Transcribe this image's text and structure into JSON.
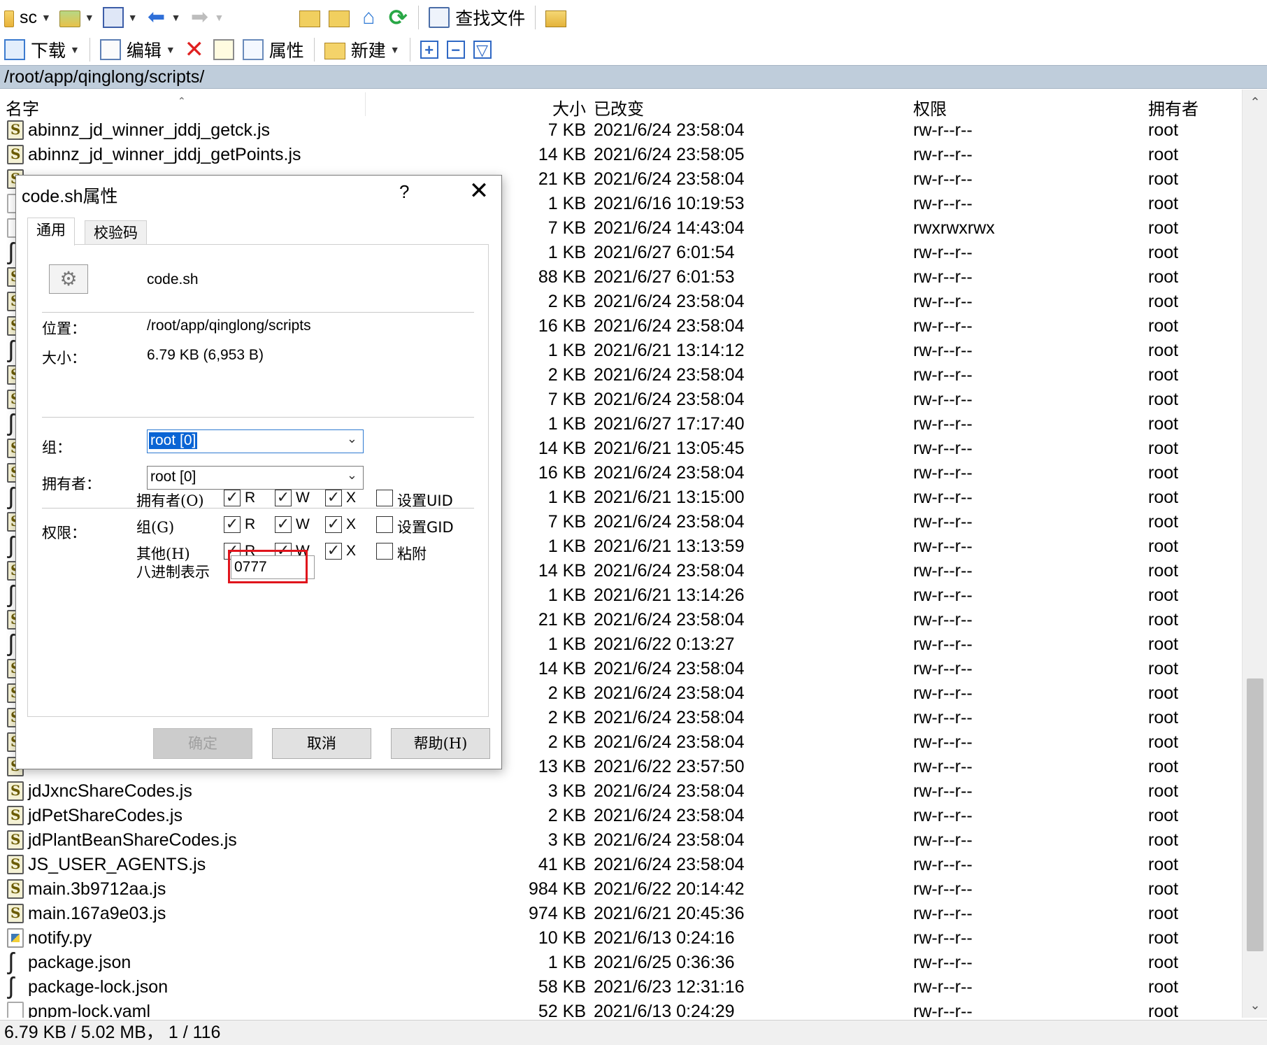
{
  "toolbar1": {
    "drive_label": "sc",
    "find_files_label": "查找文件"
  },
  "toolbar2": {
    "download_label": "下载",
    "edit_label": "编辑",
    "properties_label": "属性",
    "new_label": "新建"
  },
  "path": "/root/app/qinglong/scripts/",
  "columns": {
    "name": "名字",
    "size": "大小",
    "changed": "已改变",
    "rights": "权限",
    "owner": "拥有者"
  },
  "rows": [
    {
      "icon": "js",
      "name": "abinnz_jd_winner_jddj_getck.js",
      "size": "7 KB",
      "date": "2021/6/24 23:58:04",
      "perm": "rw-r--r--",
      "owner": "root"
    },
    {
      "icon": "js",
      "name": "abinnz_jd_winner_jddj_getPoints.js",
      "size": "14 KB",
      "date": "2021/6/24 23:58:05",
      "perm": "rw-r--r--",
      "owner": "root"
    },
    {
      "icon": "js",
      "name": "",
      "size": "21 KB",
      "date": "2021/6/24 23:58:04",
      "perm": "rw-r--r--",
      "owner": "root"
    },
    {
      "icon": "blank",
      "name": "",
      "size": "1 KB",
      "date": "2021/6/16 10:19:53",
      "perm": "rw-r--r--",
      "owner": "root"
    },
    {
      "icon": "blank",
      "name": "",
      "size": "7 KB",
      "date": "2021/6/24 14:43:04",
      "perm": "rwxrwxrwx",
      "owner": "root"
    },
    {
      "icon": "json",
      "name": "",
      "size": "1 KB",
      "date": "2021/6/27 6:01:54",
      "perm": "rw-r--r--",
      "owner": "root"
    },
    {
      "icon": "js",
      "name": "",
      "size": "88 KB",
      "date": "2021/6/27 6:01:53",
      "perm": "rw-r--r--",
      "owner": "root"
    },
    {
      "icon": "js",
      "name": "",
      "size": "2 KB",
      "date": "2021/6/24 23:58:04",
      "perm": "rw-r--r--",
      "owner": "root"
    },
    {
      "icon": "js",
      "name": "",
      "size": "16 KB",
      "date": "2021/6/24 23:58:04",
      "perm": "rw-r--r--",
      "owner": "root"
    },
    {
      "icon": "json",
      "name": "",
      "size": "1 KB",
      "date": "2021/6/21 13:14:12",
      "perm": "rw-r--r--",
      "owner": "root"
    },
    {
      "icon": "js",
      "name": "",
      "size": "2 KB",
      "date": "2021/6/24 23:58:04",
      "perm": "rw-r--r--",
      "owner": "root"
    },
    {
      "icon": "js",
      "name": "",
      "size": "7 KB",
      "date": "2021/6/24 23:58:04",
      "perm": "rw-r--r--",
      "owner": "root"
    },
    {
      "icon": "json",
      "name": "",
      "size": "1 KB",
      "date": "2021/6/27 17:17:40",
      "perm": "rw-r--r--",
      "owner": "root"
    },
    {
      "icon": "js",
      "name": "",
      "size": "14 KB",
      "date": "2021/6/21 13:05:45",
      "perm": "rw-r--r--",
      "owner": "root"
    },
    {
      "icon": "js",
      "name": "",
      "size": "16 KB",
      "date": "2021/6/24 23:58:04",
      "perm": "rw-r--r--",
      "owner": "root"
    },
    {
      "icon": "json",
      "name": "",
      "size": "1 KB",
      "date": "2021/6/21 13:15:00",
      "perm": "rw-r--r--",
      "owner": "root"
    },
    {
      "icon": "js",
      "name": "",
      "size": "7 KB",
      "date": "2021/6/24 23:58:04",
      "perm": "rw-r--r--",
      "owner": "root"
    },
    {
      "icon": "json",
      "name": "",
      "size": "1 KB",
      "date": "2021/6/21 13:13:59",
      "perm": "rw-r--r--",
      "owner": "root"
    },
    {
      "icon": "js",
      "name": "",
      "size": "14 KB",
      "date": "2021/6/24 23:58:04",
      "perm": "rw-r--r--",
      "owner": "root"
    },
    {
      "icon": "json",
      "name": "",
      "size": "1 KB",
      "date": "2021/6/21 13:14:26",
      "perm": "rw-r--r--",
      "owner": "root"
    },
    {
      "icon": "js",
      "name": "",
      "size": "21 KB",
      "date": "2021/6/24 23:58:04",
      "perm": "rw-r--r--",
      "owner": "root"
    },
    {
      "icon": "json",
      "name": "",
      "size": "1 KB",
      "date": "2021/6/22 0:13:27",
      "perm": "rw-r--r--",
      "owner": "root"
    },
    {
      "icon": "js",
      "name": "",
      "size": "14 KB",
      "date": "2021/6/24 23:58:04",
      "perm": "rw-r--r--",
      "owner": "root"
    },
    {
      "icon": "js",
      "name": "",
      "size": "2 KB",
      "date": "2021/6/24 23:58:04",
      "perm": "rw-r--r--",
      "owner": "root"
    },
    {
      "icon": "js",
      "name": "",
      "size": "2 KB",
      "date": "2021/6/24 23:58:04",
      "perm": "rw-r--r--",
      "owner": "root"
    },
    {
      "icon": "js",
      "name": "",
      "size": "2 KB",
      "date": "2021/6/24 23:58:04",
      "perm": "rw-r--r--",
      "owner": "root"
    },
    {
      "icon": "js",
      "name": "",
      "size": "13 KB",
      "date": "2021/6/22 23:57:50",
      "perm": "rw-r--r--",
      "owner": "root"
    },
    {
      "icon": "js",
      "name": "jdJxncShareCodes.js",
      "size": "3 KB",
      "date": "2021/6/24 23:58:04",
      "perm": "rw-r--r--",
      "owner": "root"
    },
    {
      "icon": "js",
      "name": "jdPetShareCodes.js",
      "size": "2 KB",
      "date": "2021/6/24 23:58:04",
      "perm": "rw-r--r--",
      "owner": "root"
    },
    {
      "icon": "js",
      "name": "jdPlantBeanShareCodes.js",
      "size": "3 KB",
      "date": "2021/6/24 23:58:04",
      "perm": "rw-r--r--",
      "owner": "root"
    },
    {
      "icon": "js",
      "name": "JS_USER_AGENTS.js",
      "size": "41 KB",
      "date": "2021/6/24 23:58:04",
      "perm": "rw-r--r--",
      "owner": "root"
    },
    {
      "icon": "js",
      "name": "main.3b9712aa.js",
      "size": "984 KB",
      "date": "2021/6/22 20:14:42",
      "perm": "rw-r--r--",
      "owner": "root"
    },
    {
      "icon": "js",
      "name": "main.167a9e03.js",
      "size": "974 KB",
      "date": "2021/6/21 20:45:36",
      "perm": "rw-r--r--",
      "owner": "root"
    },
    {
      "icon": "py",
      "name": "notify.py",
      "size": "10 KB",
      "date": "2021/6/13 0:24:16",
      "perm": "rw-r--r--",
      "owner": "root"
    },
    {
      "icon": "json",
      "name": "package.json",
      "size": "1 KB",
      "date": "2021/6/25 0:36:36",
      "perm": "rw-r--r--",
      "owner": "root"
    },
    {
      "icon": "json",
      "name": "package-lock.json",
      "size": "58 KB",
      "date": "2021/6/23 12:31:16",
      "perm": "rw-r--r--",
      "owner": "root"
    },
    {
      "icon": "blank",
      "name": "pnpm-lock.yaml",
      "size": "52 KB",
      "date": "2021/6/13 0:24:29",
      "perm": "rw-r--r--",
      "owner": "root"
    }
  ],
  "status": "6.79 KB / 5.02 MB，  1 / 116",
  "dialog": {
    "title": "code.sh属性",
    "help_glyph": "?",
    "close_glyph": "✕",
    "tabs": [
      "通用",
      "校验码"
    ],
    "file_name": "code.sh",
    "location_label": "位置：",
    "location_value": "/root/app/qinglong/scripts",
    "size_label": "大小：",
    "size_value": "6.79 KB (6,953 B)",
    "group_label": "组：",
    "group_value": "root [0]",
    "owner_label": "拥有者：",
    "owner_value": "root [0]",
    "rights_label": "权限：",
    "perm_rows": [
      {
        "label": "拥有者(O)",
        "r": true,
        "w": true,
        "x": true,
        "extra_label": "设置UID",
        "extra": false
      },
      {
        "label": "组(G)",
        "r": true,
        "w": true,
        "x": true,
        "extra_label": "设置GID",
        "extra": false
      },
      {
        "label": "其他(H)",
        "r": true,
        "w": true,
        "x": true,
        "extra_label": "粘附",
        "extra": false
      }
    ],
    "perm_letters": {
      "r": "R",
      "w": "W",
      "x": "X"
    },
    "octal_label": "八进制表示",
    "octal_value": "0777",
    "buttons": {
      "ok": "确定",
      "cancel": "取消",
      "help": "帮助(H)"
    }
  }
}
